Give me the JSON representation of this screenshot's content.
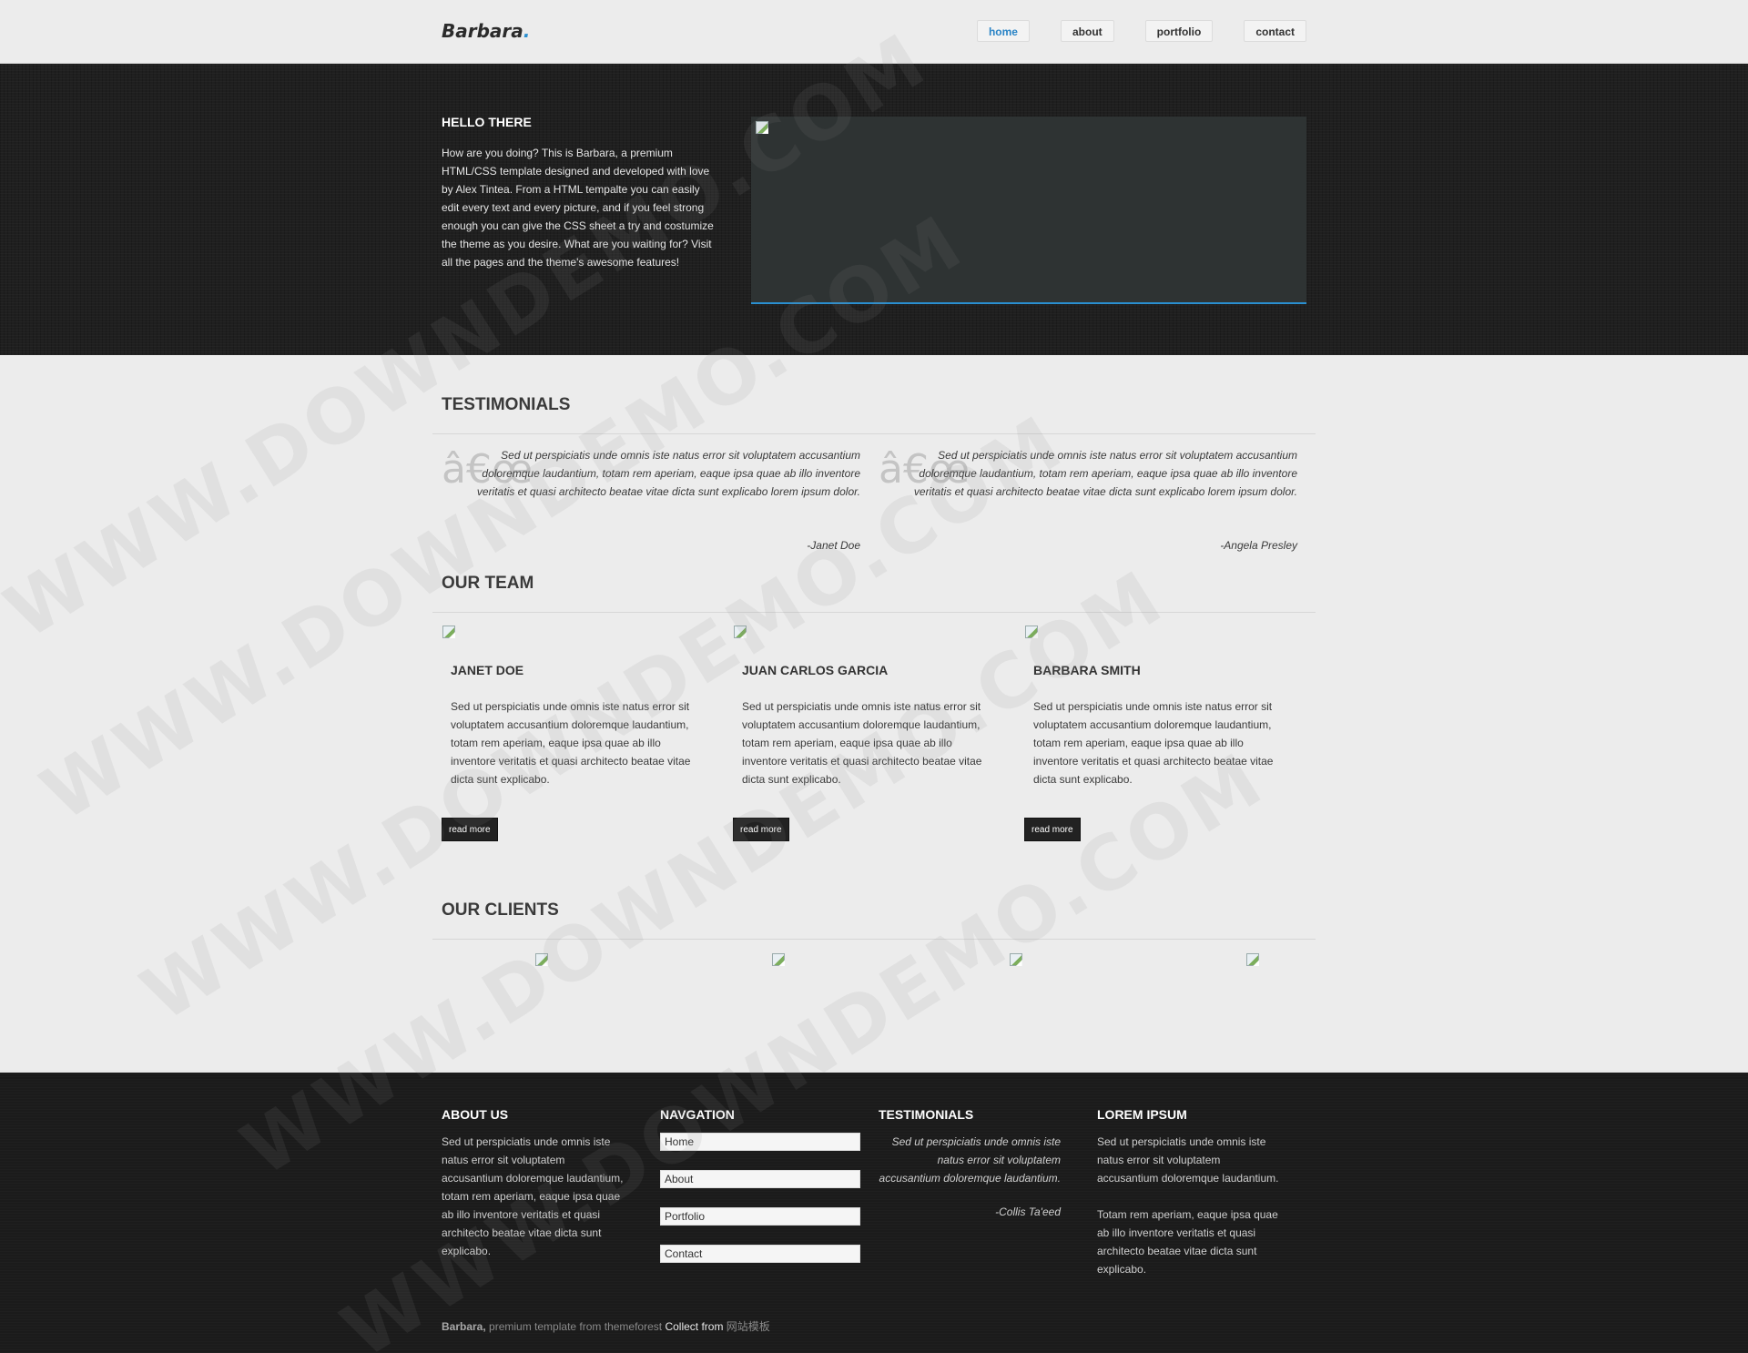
{
  "header": {
    "logo_text": "Barbara",
    "logo_dot": ".",
    "nav": [
      "home",
      "about",
      "portfolio",
      "contact"
    ]
  },
  "hero": {
    "title": "HELLO THERE",
    "text": "How are you doing? This is Barbara, a premium HTML/CSS template designed and developed with love by Alex Tintea. From a HTML tempalte you can easily edit every text and every picture, and if you feel strong enough you can give the CSS sheet a try and costumize the theme as you desire. What are you waiting for? Visit all the pages and the theme's awesome features!"
  },
  "testimonials": {
    "title": "TESTIMONIALS",
    "quote_mark": "â€œ",
    "items": [
      {
        "quote": "Sed ut perspiciatis unde omnis iste natus error sit voluptatem accusantium doloremque laudantium, totam rem aperiam, eaque ipsa quae ab illo inventore veritatis et quasi architecto beatae vitae dicta sunt explicabo lorem ipsum dolor.",
        "author": "-Janet Doe"
      },
      {
        "quote": "Sed ut perspiciatis unde omnis iste natus error sit voluptatem accusantium doloremque laudantium, totam rem aperiam, eaque ipsa quae ab illo inventore veritatis et quasi architecto beatae vitae dicta sunt explicabo lorem ipsum dolor.",
        "author": "-Angela Presley"
      }
    ]
  },
  "team": {
    "title": "OUR TEAM",
    "members": [
      {
        "name": "JANET DOE",
        "bio": "Sed ut perspiciatis unde omnis iste natus error sit voluptatem accusantium doloremque laudantium, totam rem aperiam, eaque ipsa quae ab illo inventore veritatis et quasi architecto beatae vitae dicta sunt explicabo.",
        "button": "read more"
      },
      {
        "name": "JUAN CARLOS GARCIA",
        "bio": "Sed ut perspiciatis unde omnis iste natus error sit voluptatem accusantium doloremque laudantium, totam rem aperiam, eaque ipsa quae ab illo inventore veritatis et quasi architecto beatae vitae dicta sunt explicabo.",
        "button": "read more"
      },
      {
        "name": "BARBARA SMITH",
        "bio": "Sed ut perspiciatis unde omnis iste natus error sit voluptatem accusantium doloremque laudantium, totam rem aperiam, eaque ipsa quae ab illo inventore veritatis et quasi architecto beatae vitae dicta sunt explicabo.",
        "button": "read more"
      }
    ]
  },
  "clients": {
    "title": "OUR CLIENTS"
  },
  "footer": {
    "about": {
      "title": "ABOUT US",
      "text": "Sed ut perspiciatis unde omnis iste natus error sit voluptatem accusantium doloremque laudantium, totam rem aperiam, eaque ipsa quae ab illo inventore veritatis et quasi architecto beatae vitae dicta sunt explicabo."
    },
    "navigation": {
      "title": "NAVGATION",
      "links": [
        "Home",
        "About",
        "Portfolio",
        "Contact"
      ]
    },
    "testimonials": {
      "title": "TESTIMONIALS",
      "quote": "Sed ut perspiciatis unde omnis iste natus error sit voluptatem accusantium doloremque laudantium.",
      "author": "-Collis Ta'eed"
    },
    "lorem": {
      "title": "LOREM IPSUM",
      "text1": "Sed ut perspiciatis unde omnis iste natus error sit voluptatem accusantium doloremque laudantium.",
      "text2": "Totam rem aperiam, eaque ipsa quae ab illo inventore veritatis et quasi architecto beatae vitae dicta sunt explicabo."
    },
    "copyright": {
      "brand": "Barbara,",
      "text": " premium template from themeforest ",
      "collect": "Collect from",
      "site": " 网站模板"
    }
  },
  "watermark": "WWW.DOWNDEMO.COM",
  "colors": {
    "accent": "#2a8fd0",
    "dark": "#1f1f1f",
    "light": "#ececec"
  },
  "icons": [
    "broken-image-icon"
  ]
}
